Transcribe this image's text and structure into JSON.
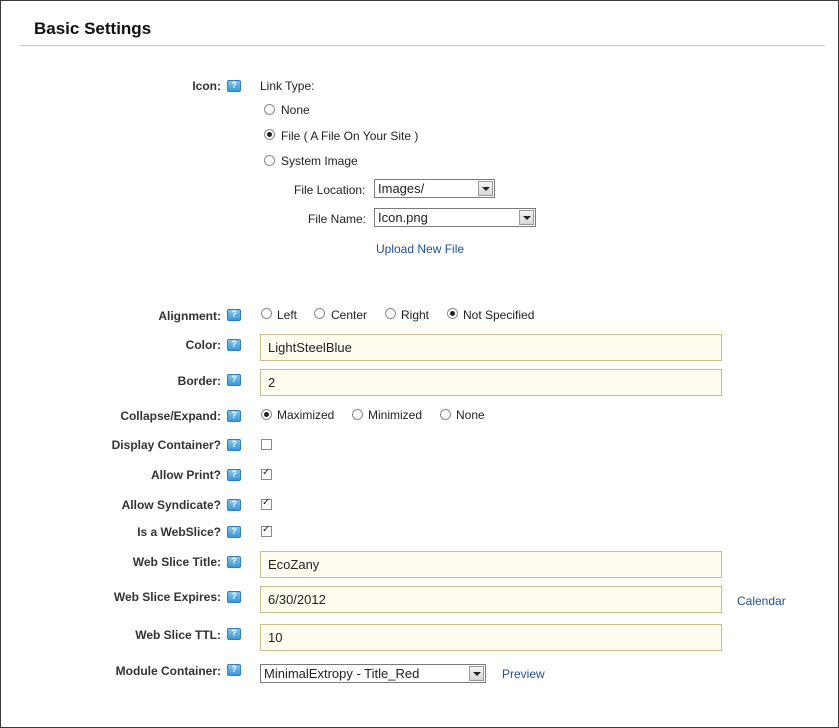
{
  "title": "Basic Settings",
  "icon": {
    "label": "Icon:",
    "link_type_label": "Link Type:",
    "options": [
      "None",
      "File ( A File On Your Site )",
      "System Image"
    ],
    "selected": "File ( A File On Your Site )",
    "file_location_label": "File Location:",
    "file_location_value": "Images/",
    "file_name_label": "File Name:",
    "file_name_value": "Icon.png",
    "upload_link": "Upload New File"
  },
  "alignment": {
    "label": "Alignment:",
    "options": [
      "Left",
      "Center",
      "Right",
      "Not Specified"
    ],
    "selected": "Not Specified"
  },
  "color": {
    "label": "Color:",
    "value": "LightSteelBlue"
  },
  "border": {
    "label": "Border:",
    "value": "2"
  },
  "collapse": {
    "label": "Collapse/Expand:",
    "options": [
      "Maximized",
      "Minimized",
      "None"
    ],
    "selected": "Maximized"
  },
  "display_container": {
    "label": "Display Container?",
    "checked": false
  },
  "allow_print": {
    "label": "Allow Print?",
    "checked": true
  },
  "allow_syndicate": {
    "label": "Allow Syndicate?",
    "checked": true
  },
  "is_webslice": {
    "label": "Is a WebSlice?",
    "checked": true
  },
  "webslice_title": {
    "label": "Web Slice Title:",
    "value": "EcoZany"
  },
  "webslice_expires": {
    "label": "Web Slice Expires:",
    "value": "6/30/2012",
    "calendar_link": "Calendar"
  },
  "webslice_ttl": {
    "label": "Web Slice TTL:",
    "value": "10"
  },
  "module_container": {
    "label": "Module Container:",
    "value": "MinimalExtropy - Title_Red",
    "preview_link": "Preview"
  },
  "colors": {
    "input_bg": "#fffdef",
    "input_border": "#c9bd8a",
    "link": "#1f4f8f",
    "help_icon": "#3d97d8"
  }
}
